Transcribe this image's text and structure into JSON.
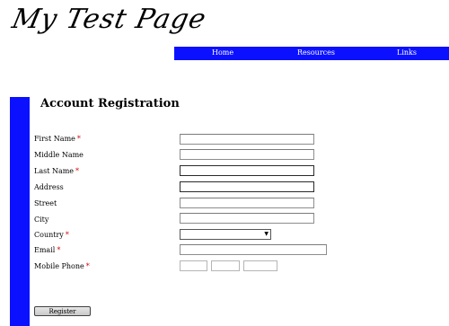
{
  "header": {
    "site_title": "My Test Page"
  },
  "nav": {
    "items": [
      {
        "label": "Home"
      },
      {
        "label": "Resources"
      },
      {
        "label": "Links"
      }
    ]
  },
  "form": {
    "heading": "Account Registration",
    "required_marker": "*",
    "fields": [
      {
        "label": "First Name",
        "required": true,
        "value": ""
      },
      {
        "label": "Middle Name",
        "required": false,
        "value": ""
      },
      {
        "label": "Last Name",
        "required": true,
        "value": ""
      },
      {
        "label": "Address",
        "required": false,
        "value": ""
      },
      {
        "label": "Street",
        "required": false,
        "value": ""
      },
      {
        "label": "City",
        "required": false,
        "value": ""
      },
      {
        "label": "Country",
        "required": true,
        "value": ""
      },
      {
        "label": "Email",
        "required": true,
        "value": ""
      },
      {
        "label": "Mobile Phone",
        "required": true,
        "value": ""
      }
    ],
    "submit_label": "Register"
  },
  "colors": {
    "accent_blue": "#0b11ff",
    "required_red": "#d00000"
  }
}
